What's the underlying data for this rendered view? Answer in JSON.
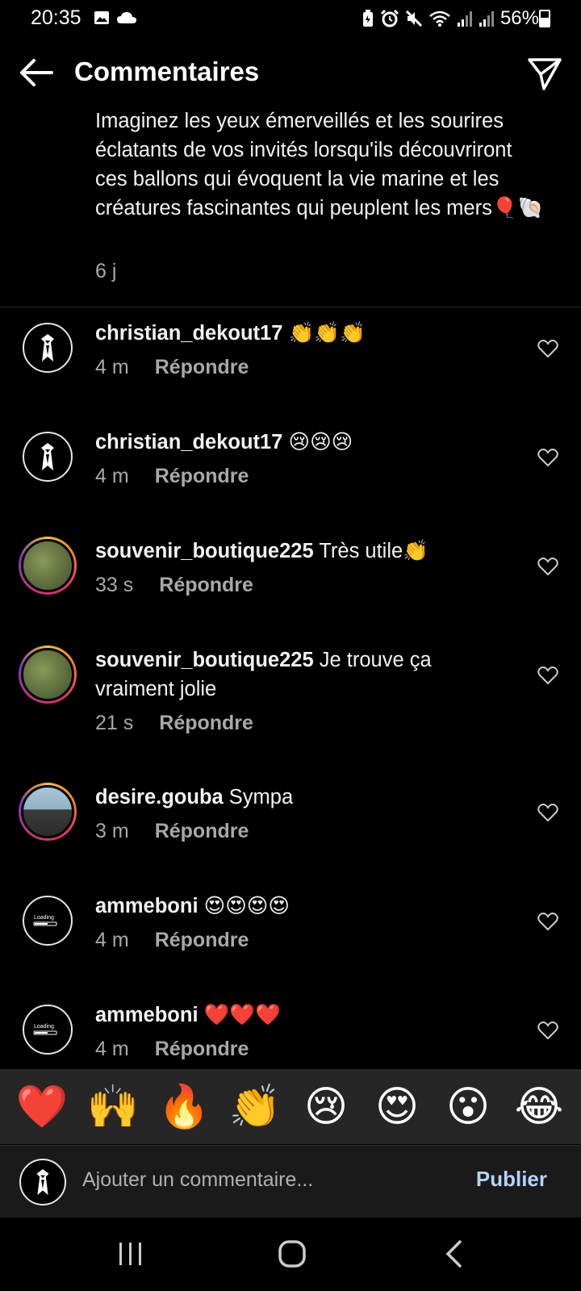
{
  "status_bar": {
    "time": "20:35",
    "battery": "56%",
    "icons_left": [
      "image-icon",
      "cloud-icon"
    ],
    "icons_right": [
      "battery-saver-icon",
      "alarm-icon",
      "mute-icon",
      "wifi-icon",
      "signal-icon",
      "signal-icon"
    ]
  },
  "header": {
    "title": "Commentaires",
    "back_icon": "arrow-left-icon",
    "send_icon": "paper-plane-icon"
  },
  "caption": {
    "text": "Imaginez les yeux émerveillés et les sourires éclatants de vos invités lorsqu'ils découvriront ces ballons qui évoquent la vie marine et les créatures fascinantes qui peuplent les mers🎈🐚",
    "time": "6 j"
  },
  "comments": [
    {
      "user": "christian_dekout17",
      "text": "👏👏👏",
      "time": "4 m",
      "reply": "Répondre"
    },
    {
      "user": "christian_dekout17",
      "text": "😢😢😢",
      "time": "4 m",
      "reply": "Répondre"
    },
    {
      "user": "souvenir_boutique225",
      "text": "Très utile👏",
      "time": "33 s",
      "reply": "Répondre"
    },
    {
      "user": "souvenir_boutique225",
      "text": "Je trouve ça vraiment jolie",
      "time": "21 s",
      "reply": "Répondre"
    },
    {
      "user": "desire.gouba",
      "text": "Sympa",
      "time": "3 m",
      "reply": "Répondre"
    },
    {
      "user": "ammeboni",
      "text": "😍😍😍😍",
      "time": "4 m",
      "reply": "Répondre"
    },
    {
      "user": "ammeboni",
      "text": "❤️❤️❤️",
      "time": "4 m",
      "reply": "Répondre"
    }
  ],
  "avatar_label": "Loading",
  "emoji_bar": [
    "❤️",
    "🙌",
    "🔥",
    "👏",
    "😢",
    "😍",
    "😮",
    "😂"
  ],
  "composer": {
    "placeholder": "Ajouter un commentaire...",
    "publish": "Publier"
  },
  "colors": {
    "background": "#000000",
    "secondary_text": "#a8a8a8",
    "publish": "#b3d4f7",
    "emoji_bar_bg": "#262626"
  }
}
